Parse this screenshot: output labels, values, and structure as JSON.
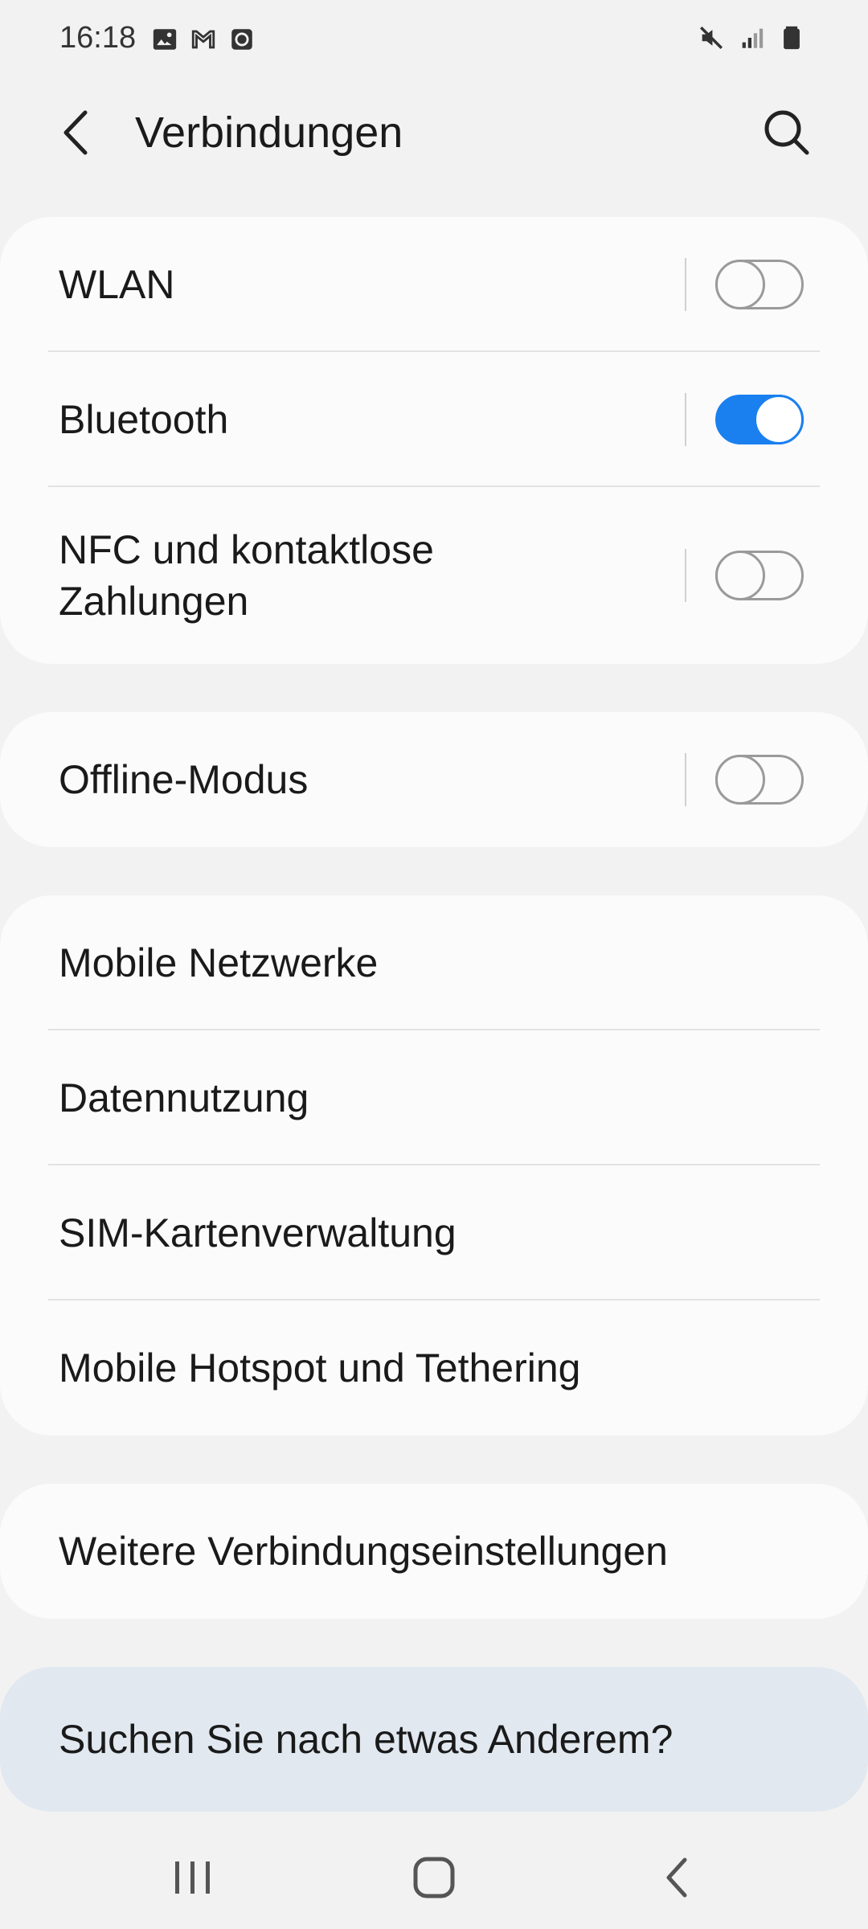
{
  "status_bar": {
    "time": "16:18",
    "left_icons": [
      "gallery-icon",
      "gmail-icon",
      "clock-app-icon"
    ],
    "right_icons": [
      "mute-icon",
      "signal-icon",
      "battery-icon"
    ]
  },
  "header": {
    "title": "Verbindungen",
    "back_icon": "chevron-left-icon",
    "search_icon": "search-icon"
  },
  "card1": [
    {
      "label": "WLAN",
      "toggle": false
    },
    {
      "label": "Bluetooth",
      "toggle": true
    },
    {
      "label": "NFC und kontaktlose\nZahlungen",
      "toggle": false
    }
  ],
  "card2": [
    {
      "label": "Offline-Modus",
      "toggle": false
    }
  ],
  "card3": [
    {
      "label": "Mobile Netzwerke"
    },
    {
      "label": "Datennutzung"
    },
    {
      "label": "SIM-Kartenverwaltung"
    },
    {
      "label": "Mobile Hotspot und Tethering"
    }
  ],
  "card4": [
    {
      "label": "Weitere Verbindungseinstellungen"
    }
  ],
  "suggestion": {
    "label": "Suchen Sie nach etwas Anderem?"
  },
  "navbar": {
    "recents_icon": "recents-icon",
    "home_icon": "home-icon",
    "back_icon": "nav-back-icon"
  },
  "colors": {
    "background": "#f2f2f2",
    "card": "#fbfbfb",
    "accent": "#1a80f0",
    "suggestion_card": "#e1e8f0"
  }
}
